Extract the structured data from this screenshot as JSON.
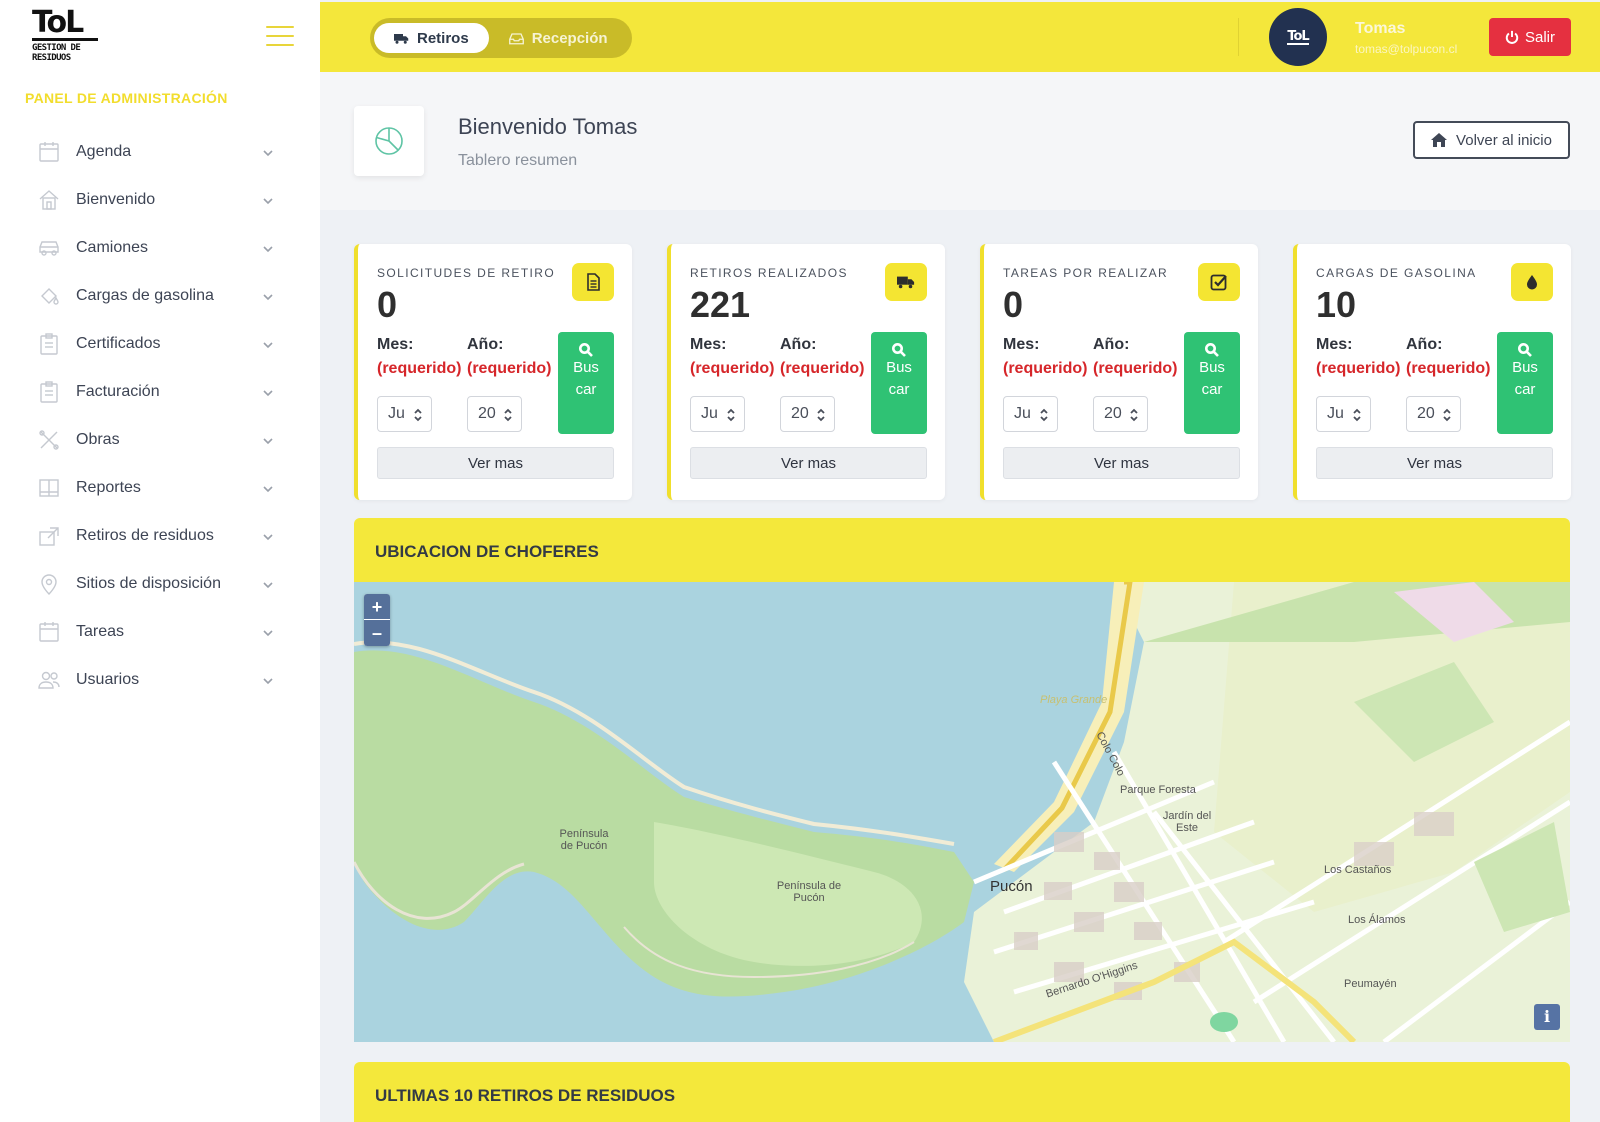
{
  "sidebar": {
    "logo_mark": "ToL",
    "logo_sub": "GESTION DE RESIDUOS",
    "panel_title": "PANEL DE ADMINISTRACIÓN",
    "items": [
      {
        "label": "Agenda",
        "icon": "calendar-icon"
      },
      {
        "label": "Bienvenido",
        "icon": "home-icon"
      },
      {
        "label": "Camiones",
        "icon": "car-icon"
      },
      {
        "label": "Cargas de gasolina",
        "icon": "paint-bucket-icon"
      },
      {
        "label": "Certificados",
        "icon": "clipboard-icon"
      },
      {
        "label": "Facturación",
        "icon": "clipboard-icon"
      },
      {
        "label": "Obras",
        "icon": "tools-icon"
      },
      {
        "label": "Reportes",
        "icon": "book-icon"
      },
      {
        "label": "Retiros de residuos",
        "icon": "share-icon"
      },
      {
        "label": "Sitios de disposición",
        "icon": "location-pin-icon"
      },
      {
        "label": "Tareas",
        "icon": "calendar-icon"
      },
      {
        "label": "Usuarios",
        "icon": "users-icon"
      }
    ]
  },
  "topbar": {
    "tabs": [
      {
        "label": "Retiros",
        "icon": "truck-icon",
        "active": true
      },
      {
        "label": "Recepción",
        "icon": "inbox-icon",
        "active": false
      }
    ],
    "avatar_text": "ToL",
    "user_name": "Tomas",
    "user_email": "tomas@tolpucon.cl",
    "logout_label": "Salir"
  },
  "header": {
    "title": "Bienvenido Tomas",
    "subtitle": "Tablero resumen",
    "home_button": "Volver al inicio"
  },
  "cards": [
    {
      "title": "SOLICITUDES DE RETIRO",
      "value": "0",
      "icon": "document-icon",
      "month_label": "Mes:",
      "year_label": "Año:",
      "month_required": "(requerido)",
      "year_required": "(requerido)",
      "month_value": "Ju",
      "year_value": "20",
      "search_label": "Buscar",
      "more_label": "Ver mas"
    },
    {
      "title": "RETIROS REALIZADOS",
      "value": "221",
      "icon": "truck-icon",
      "month_label": "Mes:",
      "year_label": "Año:",
      "month_required": "(requerido)",
      "year_required": "(requerido)",
      "month_value": "Ju",
      "year_value": "20",
      "search_label": "Buscar",
      "more_label": "Ver mas"
    },
    {
      "title": "TAREAS POR REALIZAR",
      "value": "0",
      "icon": "check-square-icon",
      "month_label": "Mes:",
      "year_label": "Año:",
      "month_required": "(requerido)",
      "year_required": "(requerido)",
      "month_value": "Ju",
      "year_value": "20",
      "search_label": "Buscar",
      "more_label": "Ver mas"
    },
    {
      "title": "CARGAS DE GASOLINA",
      "value": "10",
      "icon": "drop-icon",
      "month_label": "Mes:",
      "year_label": "Año:",
      "month_required": "(requerido)",
      "year_required": "(requerido)",
      "month_value": "Ju",
      "year_value": "20",
      "search_label": "Buscar",
      "more_label": "Ver mas"
    }
  ],
  "map_section": {
    "title": "UBICACION DE CHOFERES",
    "zoom_in": "+",
    "zoom_out": "–",
    "info": "i",
    "labels": {
      "pucon": "Pucón",
      "peninsula": "Península de Pucón",
      "playa": "Playa Grande",
      "parque": "Parque Foresta",
      "jardin": "Jardín del Este",
      "castanos": "Los Castaños",
      "alamos": "Los Álamos",
      "peumayen": "Peumayén",
      "ohiggins": "Bernardo O'Higgins",
      "colo": "Colo Colo"
    }
  },
  "retiros_section": {
    "title": "ULTIMAS 10 RETIROS DE RESIDUOS"
  },
  "colors": {
    "accent_yellow": "#f4e83b",
    "danger": "#e53040",
    "success": "#2fc274",
    "panel_title": "#f2dd2d"
  }
}
